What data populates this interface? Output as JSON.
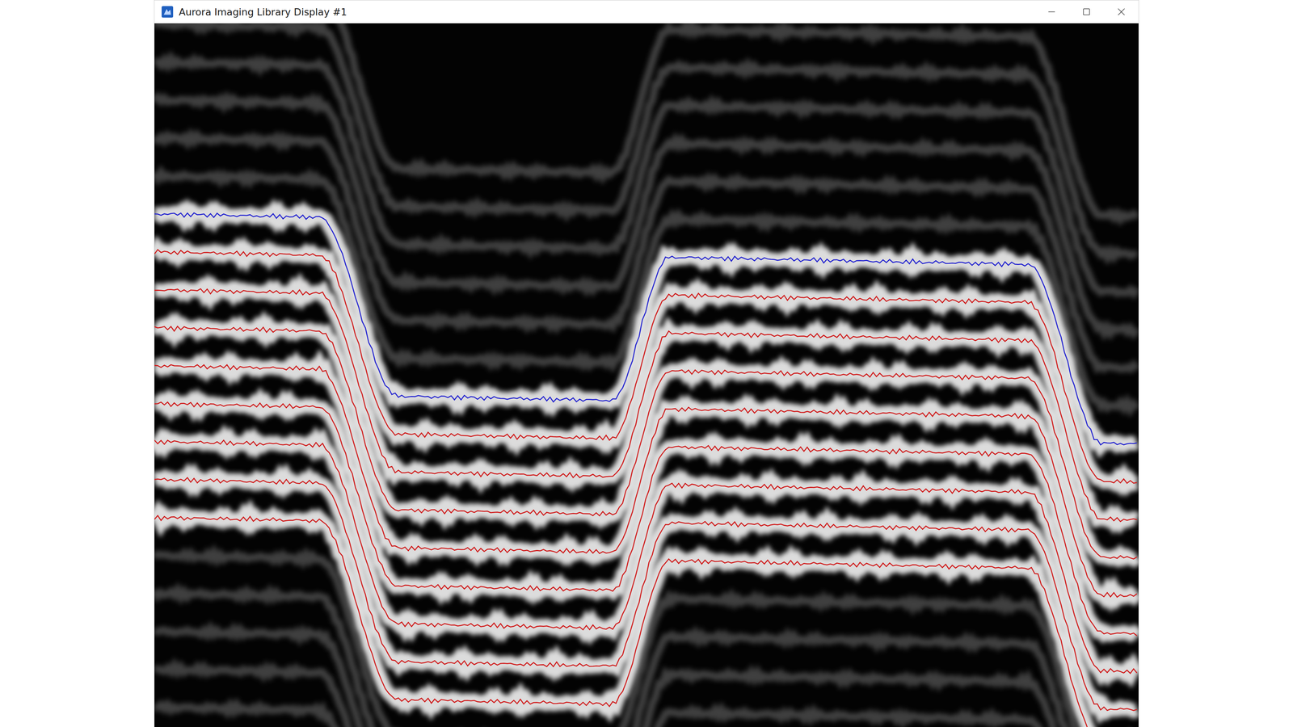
{
  "window": {
    "title": "Aurora Imaging Library Display #1"
  }
}
